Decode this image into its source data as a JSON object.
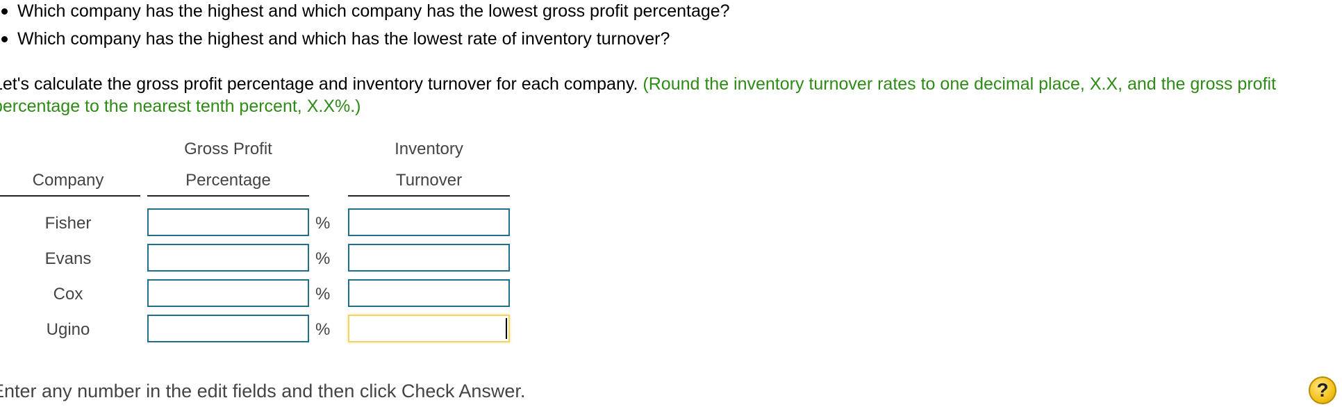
{
  "bullets": [
    "Which company has the highest and which company has the lowest gross profit percentage?",
    "Which company has the highest and which has the lowest rate of inventory turnover?"
  ],
  "instruction": {
    "text": "Let's calculate the gross profit percentage and inventory turnover for each company.",
    "hint": "(Round the inventory turnover rates to one decimal place, X.X, and the gross profit percentage to the nearest tenth percent, X.X%.)"
  },
  "table": {
    "headers": {
      "company": "Company",
      "gross_profit_line1": "Gross Profit",
      "gross_profit_line2": "Percentage",
      "inventory_line1": "Inventory",
      "inventory_line2": "Turnover"
    },
    "percent_symbol": "%",
    "rows": [
      {
        "company": "Fisher",
        "gross_profit": "",
        "inventory_turnover": ""
      },
      {
        "company": "Evans",
        "gross_profit": "",
        "inventory_turnover": ""
      },
      {
        "company": "Cox",
        "gross_profit": "",
        "inventory_turnover": ""
      },
      {
        "company": "Ugino",
        "gross_profit": "",
        "inventory_turnover": ""
      }
    ]
  },
  "footer": "Enter any number in the edit fields and then click Check Answer.",
  "help_label": "?",
  "colors": {
    "hint_green": "#2e8b16",
    "field_border": "#1f6e8c",
    "active_field_border": "#f3d36b",
    "help_yellow": "#f5c21b"
  }
}
